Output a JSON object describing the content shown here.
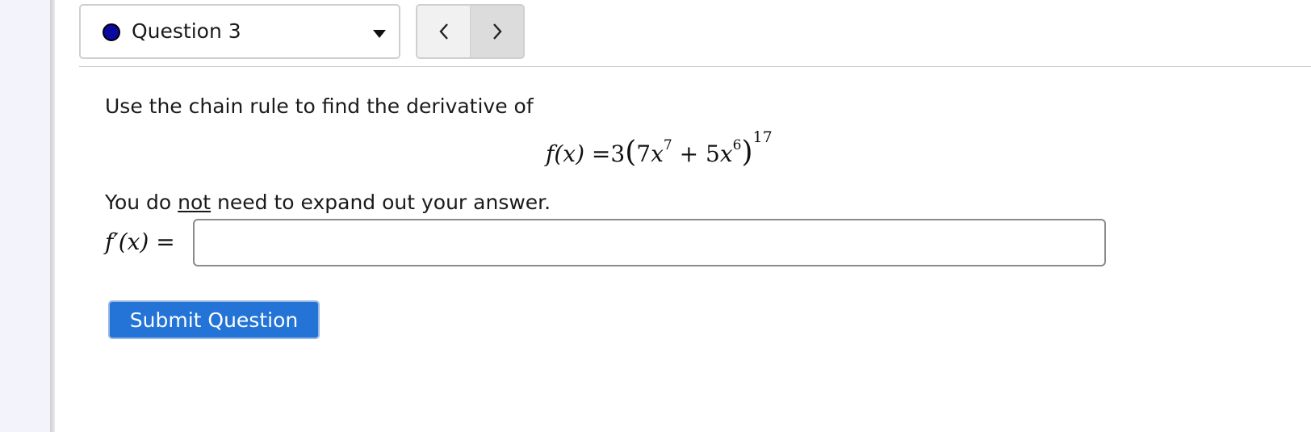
{
  "question_nav": {
    "selected": "Question 3",
    "status_color": "#0a0aa0",
    "prev_icon": "chevron-left-icon",
    "next_icon": "chevron-right-icon",
    "dropdown_icon": "caret-down-icon"
  },
  "question": {
    "prompt": "Use the chain rule to find the derivative of",
    "formula": {
      "lhs": "f(x) =",
      "coefficient": "3",
      "term1_coef": "7",
      "term1_var": "x",
      "term1_exp": "7",
      "operator": "+",
      "term2_coef": "5",
      "term2_var": "x",
      "term2_exp": "6",
      "outer_exp": "17"
    },
    "note_before": "You do ",
    "note_emphasis": "not",
    "note_after": " need to expand out your answer.",
    "answer_label": "f′(x) =",
    "answer_value": ""
  },
  "actions": {
    "submit_label": "Submit Question",
    "accent_color": "#2374d6"
  }
}
